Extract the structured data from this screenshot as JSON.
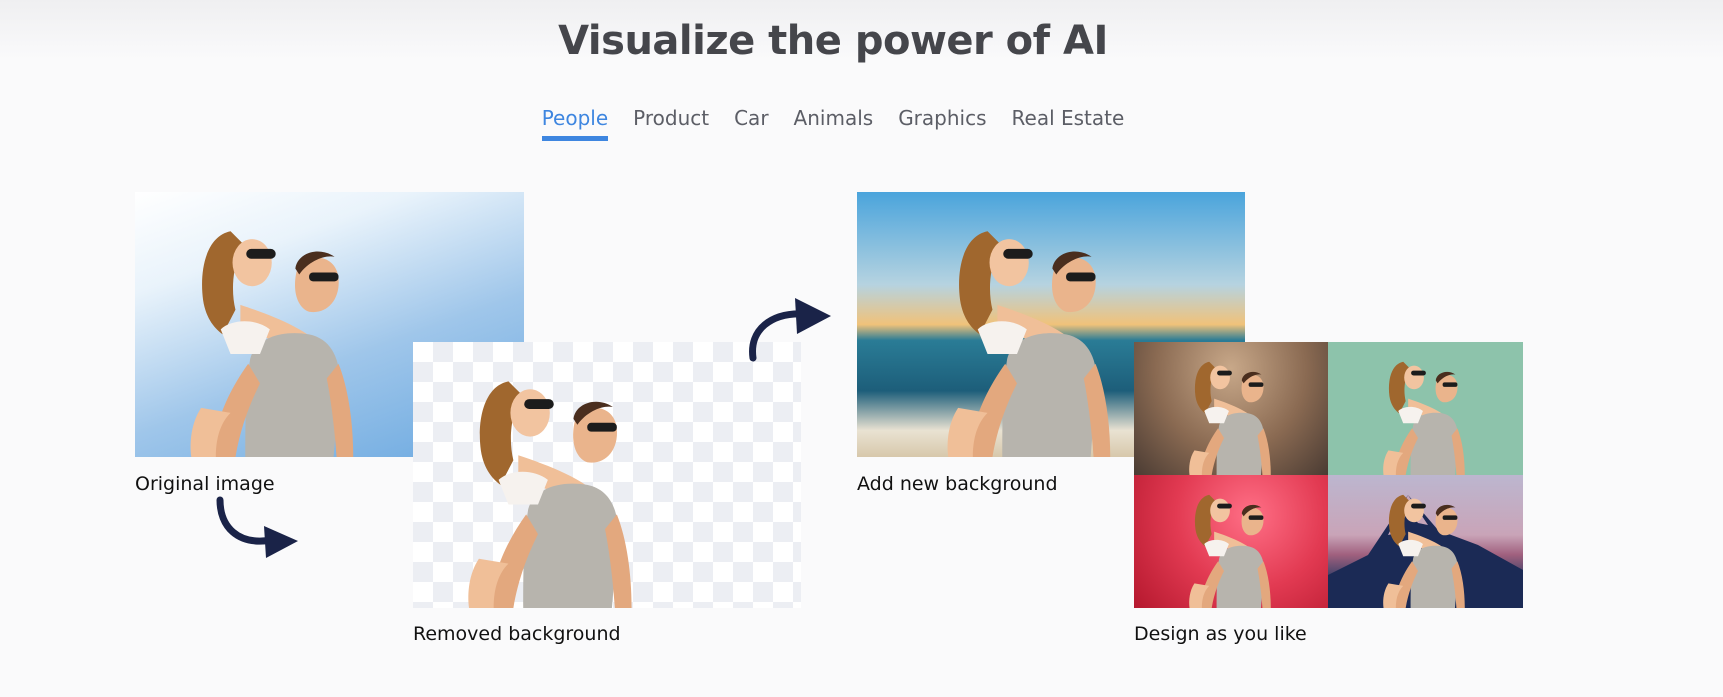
{
  "header": {
    "title": "Visualize the power of AI"
  },
  "tabs": [
    {
      "label": "People",
      "active": true
    },
    {
      "label": "Product",
      "active": false
    },
    {
      "label": "Car",
      "active": false
    },
    {
      "label": "Animals",
      "active": false
    },
    {
      "label": "Graphics",
      "active": false
    },
    {
      "label": "Real Estate",
      "active": false
    }
  ],
  "steps": {
    "original": {
      "caption": "Original image"
    },
    "removed": {
      "caption": "Removed background"
    },
    "new_bg": {
      "caption": "Add new background"
    },
    "design": {
      "caption": "Design as you like"
    }
  },
  "colors": {
    "accent": "#3e86e0",
    "title": "#45464b",
    "arrow": "#1a2348"
  },
  "icons": {
    "arrow": "curved-arrow-icon"
  }
}
